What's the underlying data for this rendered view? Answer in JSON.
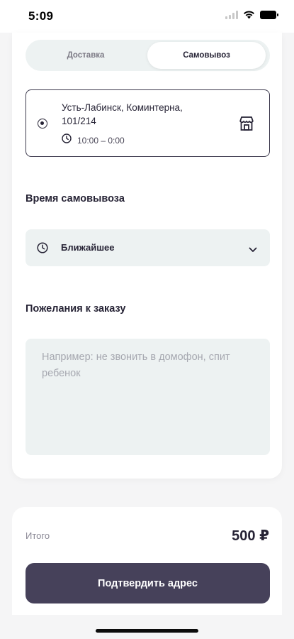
{
  "status_bar": {
    "time": "5:09"
  },
  "tabs": [
    {
      "label": "Доставка",
      "active": false
    },
    {
      "label": "Самовывоз",
      "active": true
    }
  ],
  "store": {
    "address": "Усть-Лабинск, Коминтерна, 101/214",
    "hours": "10:00 – 0:00",
    "selected": true,
    "icon": "store-icon"
  },
  "pickup_time": {
    "title": "Время самовывоза",
    "value": "Ближайшее",
    "icon": "clock-icon"
  },
  "wishes": {
    "title": "Пожелания к заказу",
    "value": "",
    "placeholder": "Например: не звонить в домофон, спит ребенок"
  },
  "summary": {
    "total_label": "Итого",
    "total_value": "500 ₽"
  },
  "confirm_button": {
    "label": "Подтвердить адрес"
  },
  "colors": {
    "accent": "#46415a",
    "field_bg": "#edf2f2",
    "page_bg": "#f5f5f6",
    "text": "#262335"
  }
}
